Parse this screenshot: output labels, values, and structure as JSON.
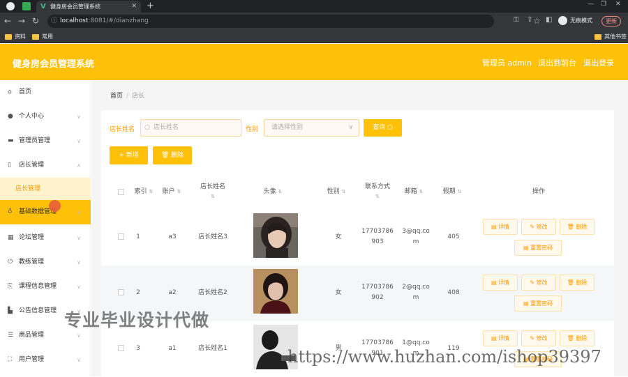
{
  "browser": {
    "tab_title": "健身房会员管理系统",
    "url_host": "localhost",
    "url_path": ":8081/#/dianzhang",
    "incognito_label": "无痕模式",
    "update_label": "更新",
    "bookmarks": [
      "资料",
      "常用"
    ],
    "other_bookmarks": "其他书签"
  },
  "header": {
    "title": "健身房会员管理系统",
    "admin": "管理员 admin",
    "back_front": "退出到前台",
    "logout": "退出登录"
  },
  "sidebar": {
    "items": [
      {
        "label": "首页",
        "icon": "home-icon"
      },
      {
        "label": "个人中心",
        "icon": "user-icon"
      },
      {
        "label": "管理员管理",
        "icon": "briefcase-icon"
      },
      {
        "label": "店长管理",
        "icon": "phone-icon"
      },
      {
        "label": "基础数据管理",
        "icon": "mic-icon"
      },
      {
        "label": "论坛管理",
        "icon": "grid-icon"
      },
      {
        "label": "教练管理",
        "icon": "power-icon"
      },
      {
        "label": "课程信息管理",
        "icon": "share-icon"
      },
      {
        "label": "公告信息管理",
        "icon": "chart-icon"
      },
      {
        "label": "商品管理",
        "icon": "list-icon"
      },
      {
        "label": "用户管理",
        "icon": "frame-icon"
      }
    ],
    "sub_active": "店长管理"
  },
  "breadcrumb": {
    "home": "首页",
    "current": "店长"
  },
  "search": {
    "name_label": "店长姓名",
    "name_placeholder": "店长姓名",
    "gender_label": "性别",
    "gender_placeholder": "请选择性别",
    "query_label": "查询"
  },
  "toolbar": {
    "add_label": "新增",
    "delete_label": "删除"
  },
  "table": {
    "headers": {
      "index": "索引",
      "account": "账户",
      "name": "店长姓名",
      "avatar": "头像",
      "gender": "性别",
      "phone": "联系方式",
      "email": "邮箱",
      "leave": "假期",
      "actions": "操作"
    },
    "rows": [
      {
        "index": "1",
        "account": "a3",
        "name": "店长姓名3",
        "gender": "女",
        "phone1": "17703786",
        "phone2": "903",
        "email1": "3@qq.co",
        "email2": "m",
        "leave": "405"
      },
      {
        "index": "2",
        "account": "a2",
        "name": "店长姓名2",
        "gender": "女",
        "phone1": "17703786",
        "phone2": "902",
        "email1": "2@qq.co",
        "email2": "m",
        "leave": "408"
      },
      {
        "index": "3",
        "account": "a1",
        "name": "店长姓名1",
        "gender": "男",
        "phone1": "17703786",
        "phone2": "901",
        "email1": "1@qq.co",
        "email2": "m",
        "leave": "119"
      }
    ],
    "actions": {
      "detail": "详情",
      "edit": "修改",
      "delete": "删除",
      "reset": "重置密码"
    }
  },
  "watermarks": {
    "cn": "专业毕业设计代做",
    "url": "https://www.huzhan.com/ishop39397"
  },
  "colors": {
    "accent": "#ffc107",
    "accent_text": "#ff9800"
  }
}
